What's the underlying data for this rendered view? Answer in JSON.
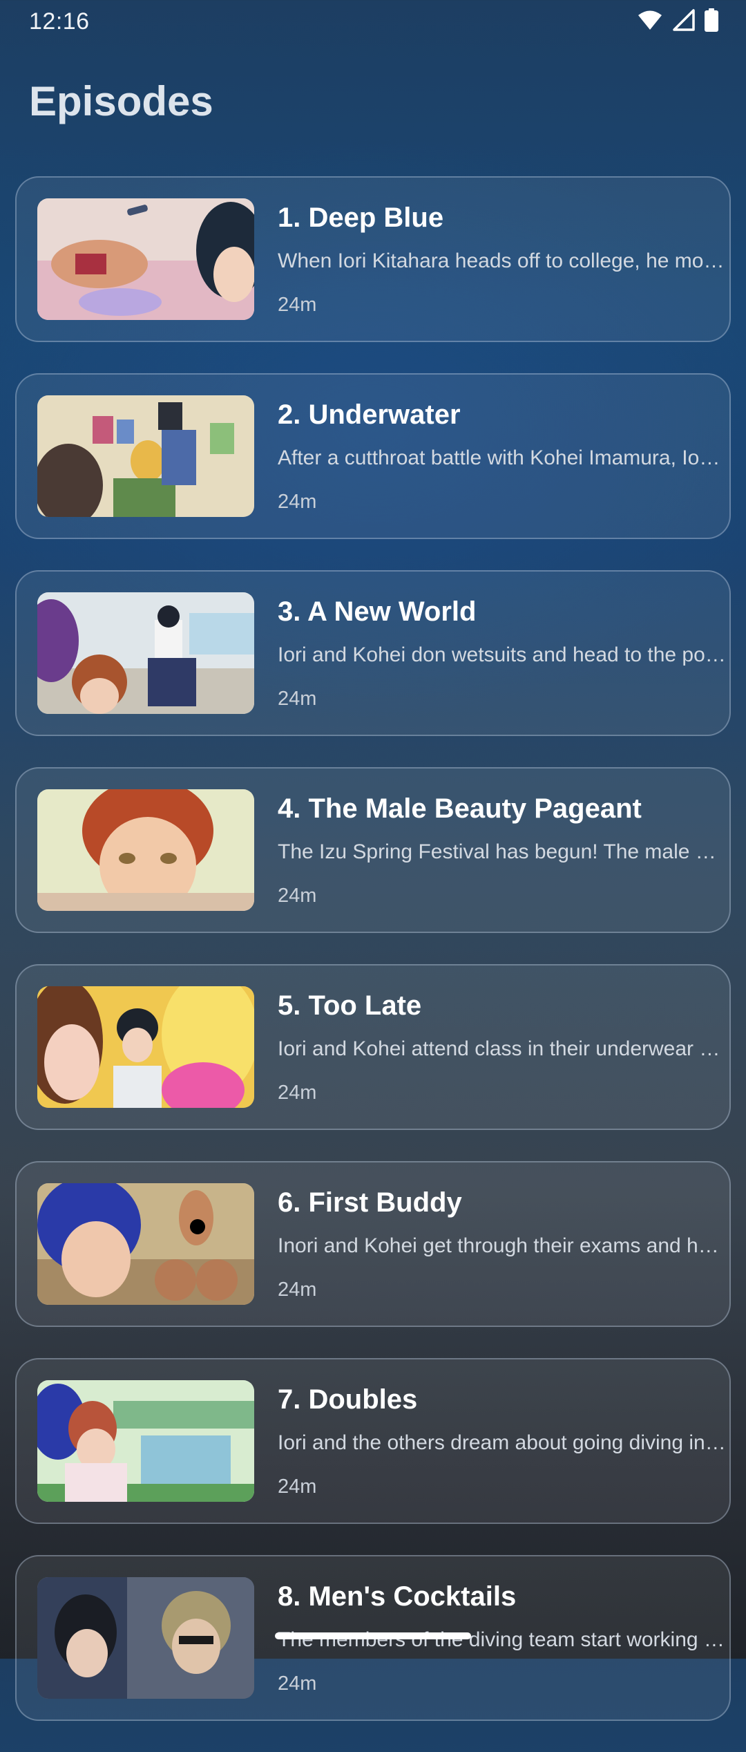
{
  "status_bar": {
    "time": "12:16",
    "icons": [
      "wifi-icon",
      "signal-icon",
      "battery-icon"
    ]
  },
  "page": {
    "title": "Episodes"
  },
  "episodes": [
    {
      "title": "1. Deep Blue",
      "description": "When Iori Kitahara heads off to college, he moves in with his uncle who runs a diving shop",
      "duration": "24m"
    },
    {
      "title": "2. Underwater",
      "description": "After a cutthroat battle with Kohei Imamura, Iori is roped into the diving club",
      "duration": "24m"
    },
    {
      "title": "3. A New World",
      "description": "Iori and Kohei don wetsuits and head to the pool for their first diving lesson",
      "duration": "24m"
    },
    {
      "title": "4. The Male Beauty Pageant",
      "description": "The Izu Spring Festival has begun! The male beauty pageant is about to start",
      "duration": "24m"
    },
    {
      "title": "5. Too Late",
      "description": "Iori and Kohei attend class in their underwear after a wild night of drinking",
      "duration": "24m"
    },
    {
      "title": "6. First Buddy",
      "description": "Inori and Kohei get through their exams and head out with the club",
      "duration": "24m"
    },
    {
      "title": "7. Doubles",
      "description": "Iori and the others dream about going diving in the open ocean this summer",
      "duration": "24m"
    },
    {
      "title": "8. Men's Cocktails",
      "description": "The members of the diving team start working at the beach bar",
      "duration": "24m"
    }
  ]
}
